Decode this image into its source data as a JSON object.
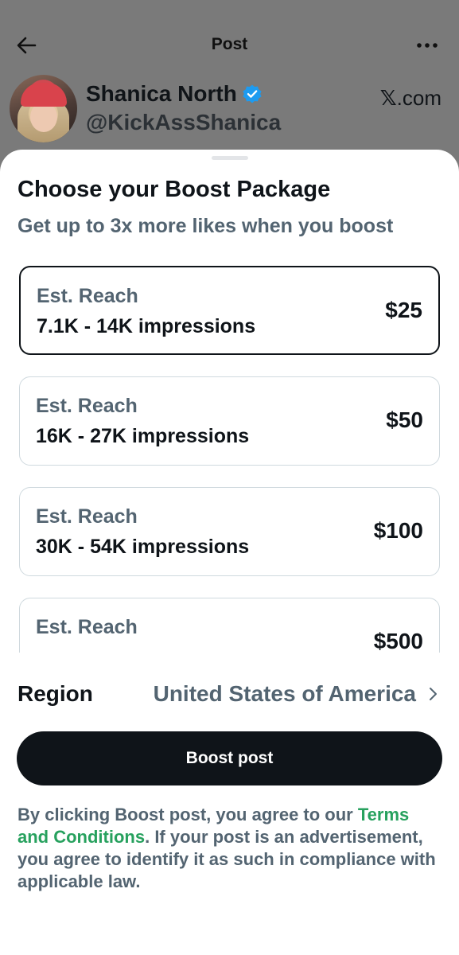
{
  "header": {
    "title": "Post",
    "back_icon": "back-arrow-icon",
    "more_icon": "more-dots-icon"
  },
  "post": {
    "author_name": "Shanica North",
    "author_handle": "@KickAssShanica",
    "verified_icon": "verified-badge-icon",
    "verified_color": "#1d9bf0",
    "source_prefix": "𝕏",
    "source_suffix": ".com"
  },
  "sheet": {
    "title": "Choose your Boost Package",
    "subtitle": "Get up to 3x more likes when you boost",
    "packages": [
      {
        "label": "Est. Reach",
        "range": "7.1K - 14K impressions",
        "price": "$25",
        "selected": true
      },
      {
        "label": "Est. Reach",
        "range": "16K - 27K impressions",
        "price": "$50",
        "selected": false
      },
      {
        "label": "Est. Reach",
        "range": "30K - 54K impressions",
        "price": "$100",
        "selected": false
      },
      {
        "label": "Est. Reach",
        "range": "",
        "price": "$500",
        "selected": false
      }
    ],
    "region_label": "Region",
    "region_value": "United States of America",
    "boost_button": "Boost post",
    "legal_before": "By clicking Boost post, you agree to our ",
    "legal_link": "Terms and Conditions",
    "legal_after": ". If your post is an advertisement, you agree to identify it as such in compliance with applicable law."
  },
  "colors": {
    "primary_text": "#0f1419",
    "secondary_text": "#536471",
    "link": "#27a15e",
    "button_bg": "#0f1419"
  }
}
